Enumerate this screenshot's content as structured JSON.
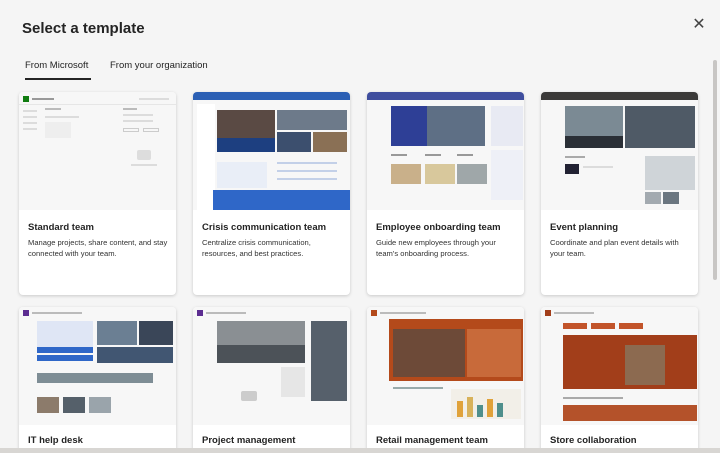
{
  "dialog": {
    "title": "Select a template",
    "close_icon": "close-icon"
  },
  "tabs": [
    {
      "label": "From Microsoft",
      "active": true
    },
    {
      "label": "From your organization",
      "active": false
    }
  ],
  "templates": [
    {
      "name": "Standard team",
      "description": "Manage projects, share content, and stay connected with your team.",
      "accent": "#107c10"
    },
    {
      "name": "Crisis communication team",
      "description": "Centralize crisis communication, resources, and best practices.",
      "accent": "#2b5fb4"
    },
    {
      "name": "Employee onboarding team",
      "description": "Guide new employees through your team's onboarding process.",
      "accent": "#3f4e9e"
    },
    {
      "name": "Event planning",
      "description": "Coordinate and plan event details with your team.",
      "accent": "#3b3a39"
    },
    {
      "name": "IT help desk",
      "description": "",
      "accent": "#5c2d91"
    },
    {
      "name": "Project management",
      "description": "",
      "accent": "#5c2d91"
    },
    {
      "name": "Retail management team",
      "description": "",
      "accent": "#b44a1b"
    },
    {
      "name": "Store collaboration",
      "description": "",
      "accent": "#a23e1a"
    }
  ]
}
